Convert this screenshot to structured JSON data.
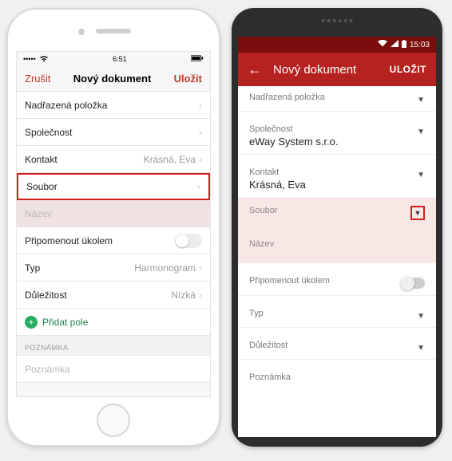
{
  "ios": {
    "status": {
      "time": "6:51",
      "carrier_signal": "•••••",
      "wifi": "wifi",
      "battery": "batt"
    },
    "nav": {
      "cancel": "Zrušit",
      "title": "Nový dokument",
      "save": "Uložit"
    },
    "rows": {
      "parent": "Nadřazená položka",
      "company": "Společnost",
      "contact_label": "Kontakt",
      "contact_value": "Krásná, Eva",
      "file": "Soubor",
      "name_placeholder": "Název",
      "remind_task": "Připomenout úkolem",
      "type_label": "Typ",
      "type_value": "Harmonogram",
      "importance_label": "Důležitost",
      "importance_value": "Nízká",
      "add_field": "Přidat pole",
      "note_section": "POZNÁMKA",
      "note_placeholder": "Poznámka"
    }
  },
  "android": {
    "status": {
      "time": "15:03"
    },
    "appbar": {
      "title": "Nový dokument",
      "save": "ULOŽIT"
    },
    "fields": {
      "parent": "Nadřazená položka",
      "company_label": "Společnost",
      "company_value": "eWay System s.r.o.",
      "contact_label": "Kontakt",
      "contact_value": "Krásná, Eva",
      "file": "Soubor",
      "name": "Název",
      "remind_task": "Připomenout úkolem",
      "type": "Typ",
      "importance": "Důležitost",
      "note": "Poznámka"
    }
  }
}
